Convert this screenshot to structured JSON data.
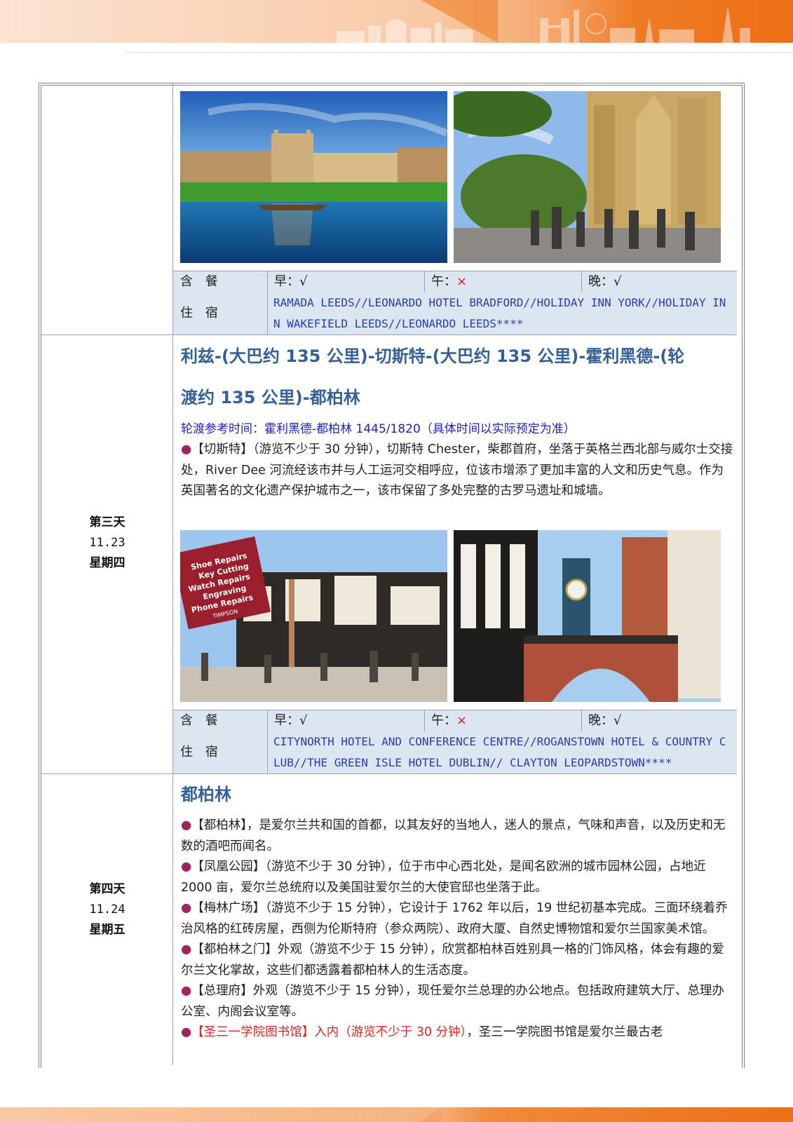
{
  "meals_header": {
    "label": "含  餐"
  },
  "hotel_header": {
    "label": "住  宿"
  },
  "day2_tail": {
    "meals": {
      "breakfast": "早：√",
      "lunch_prefix": "午：",
      "lunch_mark": "×",
      "dinner": "晚：√"
    },
    "hotel": "RAMADA LEEDS//LEONARDO HOTEL BRADFORD//HOLIDAY INN YORK//HOLIDAY INN WAKEFIELD LEEDS//LEONARDO LEEDS****"
  },
  "day3": {
    "label": "第三天",
    "date": "11.23",
    "weekday": "星期四",
    "route_line1": "利兹-(大巴约 135 公里)-切斯特-(大巴约 135 公里)-霍利黑德-(轮",
    "route_line2": "渡约 135 公里)-都柏林",
    "ferry_note": "轮渡参考时间：霍利黑德-都柏林 1445/1820（具体时间以实际预定为准）",
    "bullet": "●",
    "chester_text": "【切斯特】（游览不少于 30 分钟），切斯特 Chester，柴郡首府，坐落于英格兰西北部与威尔士交接处，River Dee 河流经该市并与人工运河交相呼应，位该市增添了更加丰富的人文和历史气息。作为英国著名的文化遗产保护城市之一，该市保留了多处完整的古罗马遗址和城墙。",
    "sign_lines": [
      "Shoe Repairs",
      "Key Cutting",
      "Watch Repairs",
      "Engraving",
      "Phone Repairs",
      "TIMPSON"
    ],
    "meals": {
      "breakfast": "早：√",
      "lunch_prefix": "午：",
      "lunch_mark": "×",
      "dinner": "晚：√"
    },
    "hotel": "CITYNORTH HOTEL AND CONFERENCE CENTRE//ROGANSTOWN HOTEL & COUNTRY CLUB//THE GREEN ISLE HOTEL DUBLIN// CLAYTON LEOPARDSTOWN****"
  },
  "day4": {
    "label": "第四天",
    "date": "11.24",
    "weekday": "星期五",
    "title": "都柏林",
    "items": [
      "【都柏林】，是爱尔兰共和国的首都，以其友好的当地人，迷人的景点，气味和声音，以及历史和无数的酒吧而闻名。",
      "【凤凰公园】（游览不少于 30 分钟），位于市中心西北处，是闻名欧洲的城市园林公园，占地近 2000 亩，爱尔兰总统府以及美国驻爱尔兰的大使官邸也坐落于此。",
      "【梅林广场】（游览不少于 15 分钟），它设计于 1762 年以后，19 世纪初基本完成。三面环绕着乔治风格的红砖房屋，西侧为伦斯特府（参众两院）、政府大厦、自然史博物馆和爱尔兰国家美术馆。",
      "【都柏林之门】外观（游览不少于 15 分钟），欣赏都柏林百姓别具一格的门饰风格，体会有趣的爱尔兰文化掌故，这些们都透露着都柏林人的生活态度。",
      "【总理府】外观（游览不少于 15 分钟），现任爱尔兰总理的办公地点。包括政府建筑大厅、总理办公室、内阁会议室等。"
    ],
    "last_red": "【圣三一学院图书馆】入内（游览不少于 30 分钟）",
    "last_rest": "，圣三一学院图书馆是爱尔兰最古老"
  },
  "colors": {
    "accent_orange": "#ed6f16",
    "table_fill": "#dce6f1",
    "title_blue": "#34609a",
    "bullet_purple": "#a3235e"
  }
}
